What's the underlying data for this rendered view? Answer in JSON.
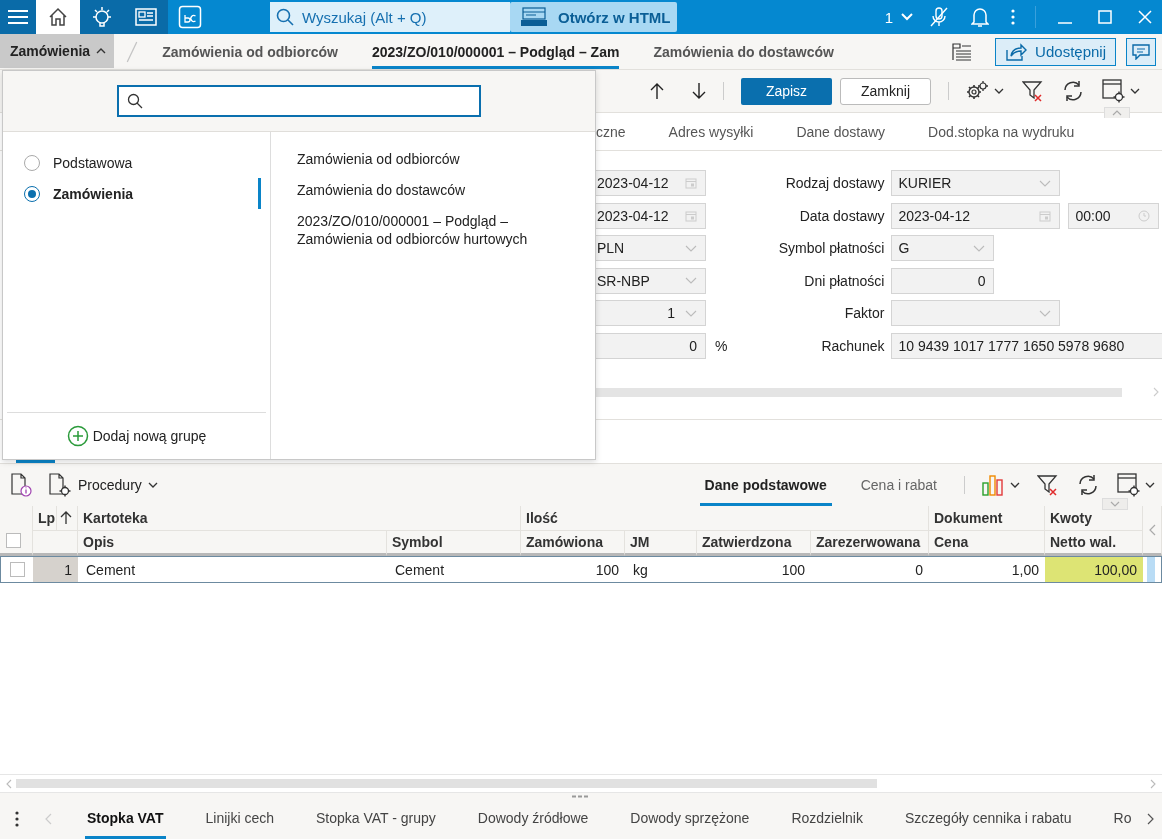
{
  "title_bar": {
    "nav_tabs": [
      {
        "kind": "home",
        "selected": true
      },
      {
        "kind": "bulb",
        "selected": false
      },
      {
        "kind": "news",
        "selected": false
      },
      {
        "kind": "bc",
        "selected": false
      }
    ],
    "search_placeholder": "Wyszukaj (Alt + Q)",
    "html_button": "Otwórz w HTML",
    "session_count": "1"
  },
  "breadcrumb": {
    "menu_button": "Zamówienia",
    "menu_expanded": true,
    "tabs": [
      {
        "label": "Zamówienia od odbiorców",
        "selected": false
      },
      {
        "label": "2023/ZO/010/000001 – Podgląd – Zam",
        "selected": true
      },
      {
        "label": "Zamówienia do dostawców",
        "selected": false
      }
    ],
    "share_button": "Udostępnij"
  },
  "toolbar": {
    "save_button": "Zapisz",
    "close_button": "Zamknij"
  },
  "form_tabs": [
    "czne",
    "Adres wysyłki",
    "Dane dostawy",
    "Dod.stopka na wydruku"
  ],
  "form": {
    "left_fields": [
      {
        "kind": "date",
        "value": "2023-04-12"
      },
      {
        "kind": "date",
        "value": "2023-04-12"
      },
      {
        "kind": "select",
        "value": "PLN"
      },
      {
        "kind": "select",
        "value": "SR-NBP"
      },
      {
        "kind": "number-select",
        "value": "1"
      },
      {
        "kind": "number",
        "value": "0",
        "unit": "%"
      }
    ],
    "right_fields": [
      {
        "label": "Rodzaj dostawy",
        "kind": "select",
        "value": "KURIER"
      },
      {
        "label": "Data dostawy",
        "kind": "date",
        "value": "2023-04-12",
        "time": "00:00"
      },
      {
        "label": "Symbol płatności",
        "kind": "select",
        "value": "G"
      },
      {
        "label": "Dni płatności",
        "kind": "number",
        "value": "0"
      },
      {
        "label": "Faktor",
        "kind": "select"
      },
      {
        "label": "Rachunek",
        "kind": "text",
        "value": "10 9439 1017 1777 1650 5978 9680"
      }
    ]
  },
  "grid_toolbar": {
    "procedures_button": "Procedury",
    "view_tabs": [
      {
        "label": "Dane podstawowe",
        "selected": true
      },
      {
        "label": "Cena i rabat",
        "selected": false
      }
    ]
  },
  "table": {
    "select_all_checked": false,
    "lp_header": "Lp",
    "lp_sorted_ascending": true,
    "group_headers": [
      "Kartoteka",
      "Ilość",
      "Dokument",
      "Kwoty"
    ],
    "columns": [
      "Opis",
      "Symbol",
      "Zamówiona",
      "JM",
      "Zatwierdzona",
      "Zarezerwowana",
      "Cena",
      "Netto wal."
    ],
    "rows": [
      {
        "checked": false,
        "lp": "1",
        "cells": [
          {
            "text": "Cement",
            "highlighted": false
          },
          {
            "text": "Cement",
            "highlighted": false
          },
          {
            "text": "100",
            "highlighted": false
          },
          {
            "text": "kg",
            "highlighted": false
          },
          {
            "text": "100",
            "highlighted": false
          },
          {
            "text": "0",
            "highlighted": false
          },
          {
            "text": "1,00",
            "highlighted": false
          },
          {
            "text": "100,00",
            "highlighted": true
          }
        ]
      }
    ]
  },
  "bottom_tabs": [
    {
      "label": "Stopka VAT",
      "selected": true
    },
    {
      "label": "Linijki cech",
      "selected": false
    },
    {
      "label": "Stopka VAT - grupy",
      "selected": false
    },
    {
      "label": "Dowody źródłowe",
      "selected": false
    },
    {
      "label": "Dowody sprzężone",
      "selected": false
    },
    {
      "label": "Rozdzielnik",
      "selected": false
    },
    {
      "label": "Szczegóły cennika i rabatu",
      "selected": false
    },
    {
      "label": "Ro",
      "selected": false
    }
  ],
  "group_menu": {
    "groups": [
      {
        "label": "Podstawowa",
        "selected": false
      },
      {
        "label": "Zamówienia",
        "selected": true
      }
    ],
    "items": [
      "Zamówienia od odbiorców",
      "Zamówienia do dostawców",
      "2023/ZO/010/000001 – Podgląd – Zamówienia od odbiorców hurtowych"
    ],
    "add_button": "Dodaj nową grupę"
  }
}
